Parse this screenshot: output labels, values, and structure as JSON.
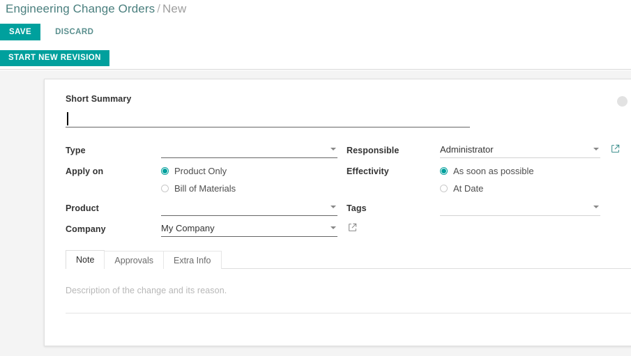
{
  "breadcrumb": {
    "root": "Engineering Change Orders",
    "separator": "/",
    "leaf": "New"
  },
  "toolbar": {
    "save_label": "SAVE",
    "discard_label": "DISCARD",
    "start_new_revision_label": "START NEW REVISION"
  },
  "colors": {
    "accent_teal": "#00A09D",
    "breadcrumb_root": "#4A7F7E",
    "breadcrumb_leaf": "#9E9E9E",
    "page_background": "#F4F4F4",
    "sheet_background": "#FFFFFF",
    "field_underline": "#666666",
    "placeholder_text": "#B7B7B7"
  },
  "form": {
    "summary": {
      "label": "Short Summary",
      "value": "",
      "placeholder": ""
    },
    "left_fields": [
      {
        "label": "Type",
        "value": "",
        "icon": "chevron-down-icon",
        "has_external_link": false
      },
      {
        "label": "Product",
        "value": "",
        "icon": "chevron-down-icon",
        "has_external_link": false
      },
      {
        "label": "Company",
        "value": "My Company",
        "icon": "chevron-down-icon",
        "has_external_link": true
      }
    ],
    "right_fields": [
      {
        "label": "Responsible",
        "value": "Administrator",
        "icon": "chevron-down-icon",
        "has_external_link": true
      },
      {
        "label": "Tags",
        "value": "",
        "icon": "chevron-down-icon",
        "has_external_link": false
      }
    ],
    "apply_on": {
      "label": "Apply on",
      "options": [
        {
          "label": "Product Only",
          "selected": true
        },
        {
          "label": "Bill of Materials",
          "selected": false
        }
      ]
    },
    "effectivity": {
      "label": "Effectivity",
      "options": [
        {
          "label": "As soon as possible",
          "selected": true
        },
        {
          "label": "At Date",
          "selected": false
        }
      ]
    }
  },
  "notebook": {
    "tabs": [
      {
        "label": "Note",
        "active": true
      },
      {
        "label": "Approvals",
        "active": false
      },
      {
        "label": "Extra Info",
        "active": false
      }
    ],
    "note_placeholder": "Description of the change and its reason."
  },
  "icons": {
    "external_link": "external-link-icon",
    "chevron_down": "chevron-down-icon",
    "avatar": "avatar-placeholder-icon"
  }
}
